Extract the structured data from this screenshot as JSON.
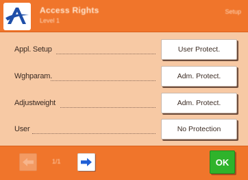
{
  "header": {
    "title": "Access Rights",
    "subtitle": "Level 1",
    "right_text": "Setup",
    "logo_icon": "a-logo-icon"
  },
  "rows": [
    {
      "label": "Appl. Setup",
      "button": "User Protect."
    },
    {
      "label": "Wghparam.",
      "button": "Adm. Protect."
    },
    {
      "label": "Adjustweight",
      "button": "Adm. Protect."
    },
    {
      "label": "User",
      "button": "No Protection"
    }
  ],
  "footer": {
    "back_icon": "arrow-left-icon",
    "forward_icon": "arrow-right-icon",
    "page_indicator": "1/1",
    "ok_label": "OK"
  },
  "colors": {
    "header_orange": "#f0752b",
    "body_peach": "#f7c9a4",
    "ok_green": "#2fb32b",
    "arrow_blue": "#1f5fd6"
  }
}
